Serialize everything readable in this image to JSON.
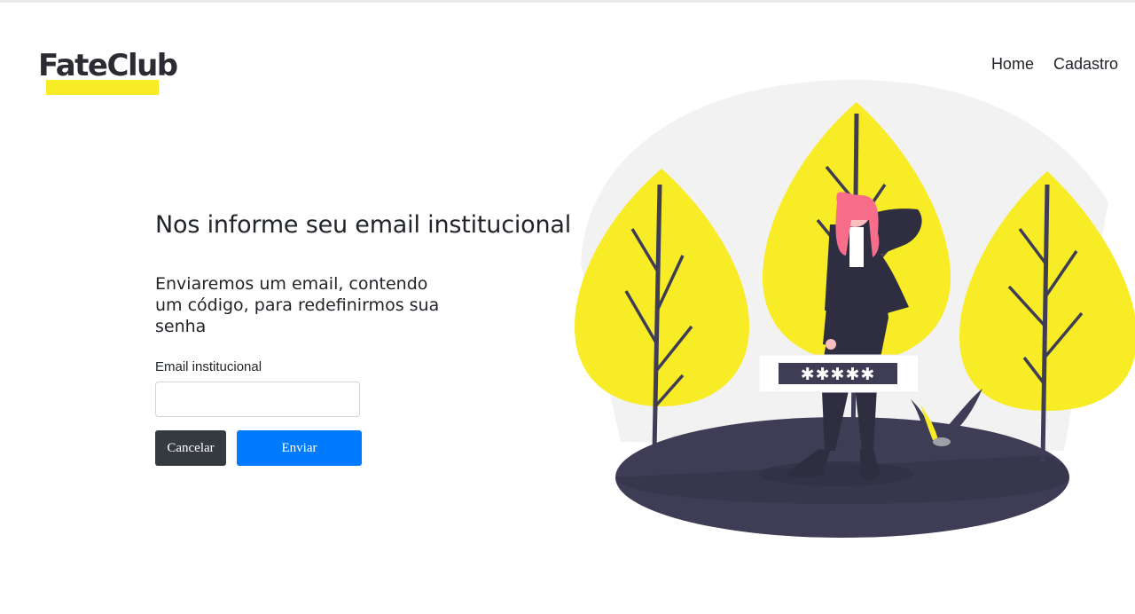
{
  "brand": {
    "name": "FateClub",
    "accent": "#f7ec26",
    "text_color": "#2b2b33"
  },
  "nav": {
    "items": [
      "Home",
      "Cadastro"
    ]
  },
  "form": {
    "title": "Nos informe seu email institucional",
    "subtitle": "Enviaremos um email, contendo um código, para redefinirmos sua senha",
    "email_label": "Email institucional",
    "email_value": "",
    "email_placeholder": "",
    "cancel_label": "Cancelar",
    "submit_label": "Enviar"
  },
  "illustration": {
    "masked_password": "✱✱✱✱✱"
  },
  "colors": {
    "primary": "#007bff",
    "dark": "#343a40",
    "tree": "#f7ec26",
    "ground": "#3f3d56"
  }
}
